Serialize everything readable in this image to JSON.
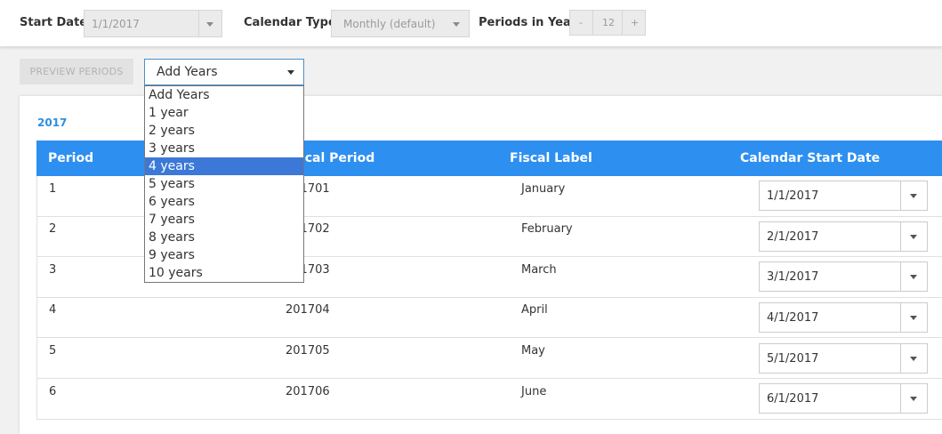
{
  "toolbar": {
    "start_date_label": "Start Date",
    "start_date_value": "1/1/2017",
    "calendar_type_label": "Calendar Type",
    "calendar_type_value": "Monthly (default)",
    "periods_label": "Periods in Year",
    "periods_minus": "-",
    "periods_value": "12",
    "periods_plus": "+"
  },
  "actions": {
    "preview_label": "PREVIEW PERIODS",
    "add_years_value": "Add Years",
    "add_years_options": [
      "Add Years",
      "1 year",
      "2 years",
      "3 years",
      "4 years",
      "5 years",
      "6 years",
      "7 years",
      "8 years",
      "9 years",
      "10 years"
    ],
    "add_years_highlighted": "4 years"
  },
  "table": {
    "year": "2017",
    "headers": [
      "Period",
      "Fiscal Period",
      "Fiscal Label",
      "Calendar Start Date"
    ],
    "rows": [
      {
        "period": "1",
        "fiscal_period": "201701",
        "fiscal_label": "January",
        "start_date": "1/1/2017"
      },
      {
        "period": "2",
        "fiscal_period": "201702",
        "fiscal_label": "February",
        "start_date": "2/1/2017"
      },
      {
        "period": "3",
        "fiscal_period": "201703",
        "fiscal_label": "March",
        "start_date": "3/1/2017"
      },
      {
        "period": "4",
        "fiscal_period": "201704",
        "fiscal_label": "April",
        "start_date": "4/1/2017"
      },
      {
        "period": "5",
        "fiscal_period": "201705",
        "fiscal_label": "May",
        "start_date": "5/1/2017"
      },
      {
        "period": "6",
        "fiscal_period": "201706",
        "fiscal_label": "June",
        "start_date": "6/1/2017"
      }
    ]
  },
  "colors": {
    "header_blue": "#2d8ff0",
    "link_blue": "#2d8fe0",
    "highlight": "#3b78d8"
  },
  "icons": {
    "dropdown_caret": "chevron-down-icon"
  }
}
